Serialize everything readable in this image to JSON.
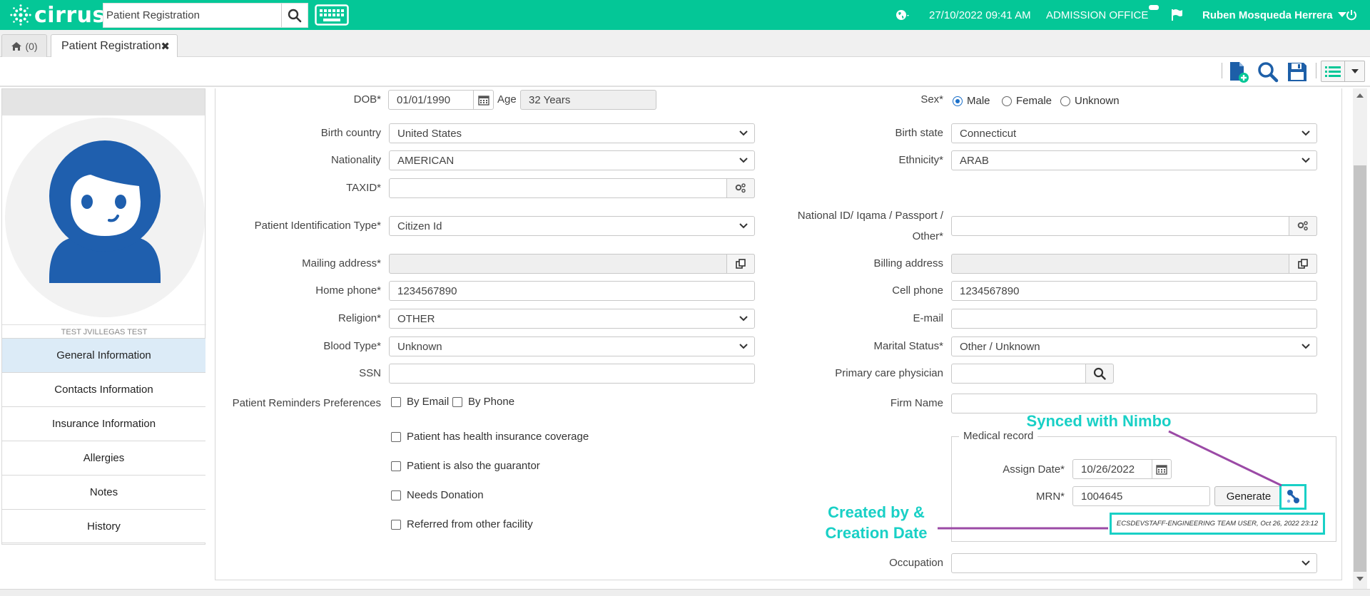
{
  "app": {
    "brand": "cirrus",
    "search_value": "Patient Registration",
    "datetime": "27/10/2022 09:41 AM",
    "office": "ADMISSION OFFICE",
    "user_name": "Ruben Mosqueda Herrera",
    "accent_color": "#04c797"
  },
  "tabs": {
    "home_count": "(0)",
    "active_tab": "Patient Registration"
  },
  "patient": {
    "name": "TEST JVILLEGAS TEST"
  },
  "nav": [
    {
      "label": "General Information",
      "active": true
    },
    {
      "label": "Contacts Information"
    },
    {
      "label": "Insurance Information"
    },
    {
      "label": "Allergies"
    },
    {
      "label": "Notes"
    },
    {
      "label": "History"
    }
  ],
  "form": {
    "dob_label": "DOB*",
    "dob_value": "01/01/1990",
    "age_label": "Age",
    "age_value": "32 Years",
    "sex_label": "Sex*",
    "sex_options": [
      "Male",
      "Female",
      "Unknown"
    ],
    "sex_selected": "Male",
    "birth_country_label": "Birth country",
    "birth_country_value": "United States",
    "birth_state_label": "Birth state",
    "birth_state_value": "Connecticut",
    "nationality_label": "Nationality",
    "nationality_value": "AMERICAN",
    "ethnicity_label": "Ethnicity*",
    "ethnicity_value": "ARAB",
    "taxid_label": "TAXID*",
    "taxid_value": "",
    "pid_type_label": "Patient Identification Type*",
    "pid_type_value": "Citizen Id",
    "national_id_label_1": "National ID/ Iqama / Passport /",
    "national_id_label_2": "Other*",
    "national_id_value": "",
    "mailing_label": "Mailing address*",
    "billing_label": "Billing address",
    "home_phone_label": "Home phone*",
    "home_phone_value": "1234567890",
    "cell_phone_label": "Cell phone",
    "cell_phone_value": "1234567890",
    "religion_label": "Religion*",
    "religion_value": "OTHER",
    "email_label": "E-mail",
    "email_value": "",
    "blood_label": "Blood Type*",
    "blood_value": "Unknown",
    "marital_label": "Marital Status*",
    "marital_value": "Other / Unknown",
    "ssn_label": "SSN",
    "ssn_value": "",
    "pcp_label": "Primary care physician",
    "pcp_value": "",
    "reminders_label": "Patient Reminders Preferences",
    "by_email": "By Email",
    "by_phone": "By Phone",
    "firm_label": "Firm Name",
    "firm_value": "",
    "cb_insurance": "Patient has health insurance coverage",
    "cb_guarantor": "Patient is also the guarantor",
    "cb_donation": "Needs Donation",
    "cb_referred": "Referred from other facility",
    "occupation_label": "Occupation",
    "occupation_value": ""
  },
  "medical_record": {
    "legend": "Medical record",
    "assign_label": "Assign Date*",
    "assign_value": "10/26/2022",
    "mrn_label": "MRN*",
    "mrn_value": "1004645",
    "generate_label": "Generate",
    "created_text": "ECSDEVSTAFF-ENGINEERING TEAM USER, Oct 26, 2022 23:12"
  },
  "annotations": {
    "synced": "Synced with Nimbo",
    "created_1": "Created by &",
    "created_2": "Creation Date",
    "color": "#19d0c6",
    "line_color": "#9b4aa6"
  }
}
